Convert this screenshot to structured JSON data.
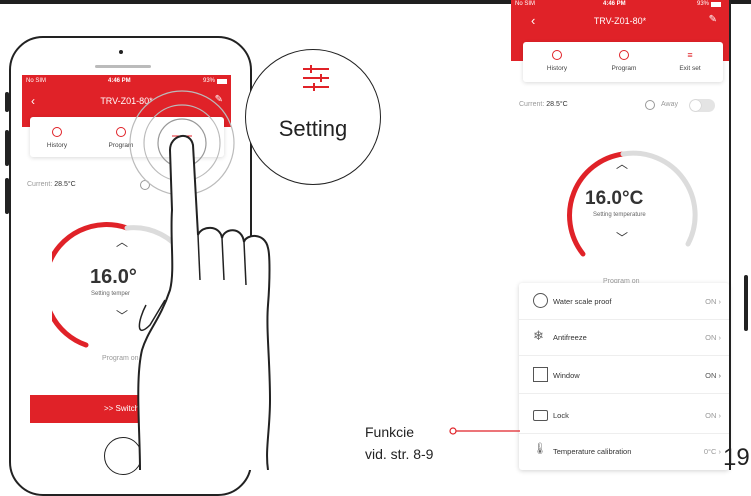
{
  "left_phone": {
    "status": {
      "carrier": "No SIM",
      "time": "4:46 PM",
      "battery": "93%"
    },
    "title": "TRV-Z01-80*",
    "tabs": [
      {
        "label": "History",
        "icon": "clock-icon"
      },
      {
        "label": "Program",
        "icon": "minus-circle-icon"
      }
    ],
    "current_label": "Current:",
    "current_value": "28.5°C",
    "temperature": "16.0°",
    "setting_label": "Setting temper",
    "program_status": "Program on",
    "switch_button": ">> Switch off"
  },
  "bubble": {
    "label": "Setting",
    "icon": "settings-sliders-icon"
  },
  "right_phone": {
    "status": {
      "carrier": "No SIM",
      "time": "4:46 PM",
      "battery": "93%"
    },
    "title": "TRV-Z01-80*",
    "tabs": [
      {
        "label": "History",
        "icon": "clock-icon"
      },
      {
        "label": "Program",
        "icon": "minus-circle-icon"
      },
      {
        "label": "Exit set",
        "icon": "sliders-icon"
      }
    ],
    "current_label": "Current:",
    "current_value": "28.5°C",
    "away_label": "Away",
    "temperature": "16.0°C",
    "setting_label": "Setting temperature",
    "program_status": "Program on",
    "settings": [
      {
        "label": "Water scale proof",
        "value": "ON",
        "icon": "water-scale-icon"
      },
      {
        "label": "Antifreeze",
        "value": "ON",
        "icon": "snowflake-icon"
      },
      {
        "label": "Window",
        "value": "ON",
        "icon": "window-icon"
      },
      {
        "label": "Lock",
        "value": "ON",
        "icon": "lock-icon"
      },
      {
        "label": "Temperature calibration",
        "value": "0°C",
        "icon": "thermometer-icon"
      }
    ]
  },
  "annotation": {
    "line1": "Funkcie",
    "line2": "vid. str. 8-9"
  },
  "page_number": "19",
  "colors": {
    "accent": "#e02228",
    "dial_track": "#dcdcdc"
  }
}
